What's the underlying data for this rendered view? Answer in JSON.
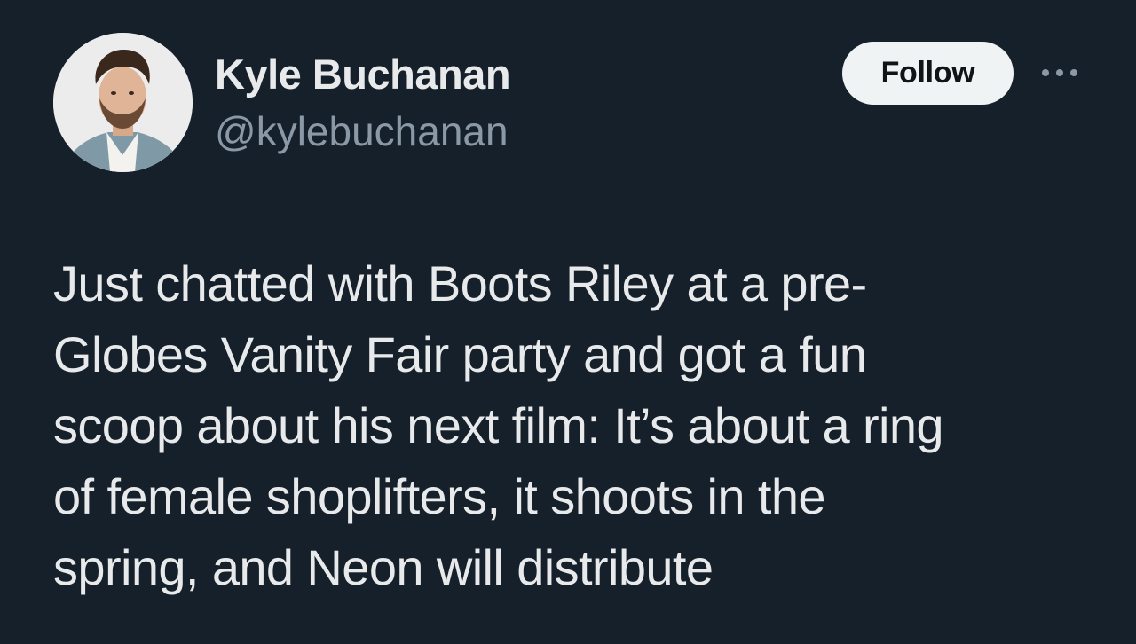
{
  "author": {
    "display_name": "Kyle Buchanan",
    "handle": "@kylebuchanan",
    "avatar_icon": "profile-photo"
  },
  "actions": {
    "follow_label": "Follow",
    "more_icon": "more-dots-icon"
  },
  "tweet": {
    "lines": [
      "Just chatted with Boots Riley at a pre-",
      "Globes Vanity Fair party and got a fun",
      "scoop about his next film: It’s about a ring",
      "of female shoplifters, it shoots in the",
      "spring, and Neon will distribute"
    ]
  },
  "colors": {
    "background": "#15202b",
    "text": "#e7e9ea",
    "secondary_text": "#8b98a5",
    "follow_button_bg": "#eff3f4",
    "follow_button_text": "#0f1419"
  }
}
